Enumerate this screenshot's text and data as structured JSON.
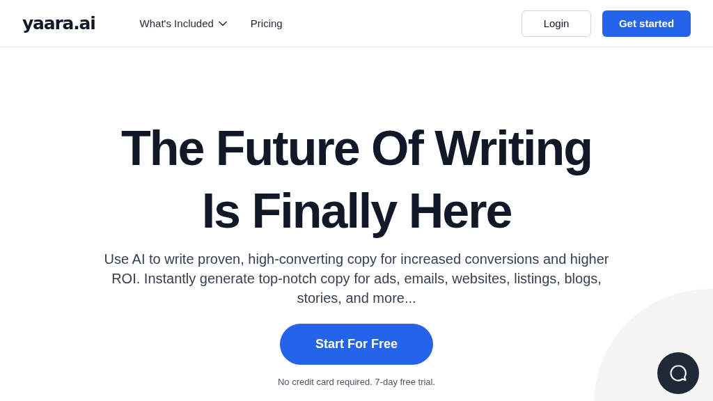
{
  "header": {
    "logo": "yaara.ai",
    "nav": [
      {
        "label": "What's Included",
        "dropdown": true
      },
      {
        "label": "Pricing",
        "dropdown": false
      }
    ],
    "buttons": [
      {
        "label": "Login",
        "kind": "outline"
      },
      {
        "label": "Get started",
        "kind": "primary"
      }
    ]
  },
  "hero": {
    "title_lines": [
      "The Future Of Writing",
      "Is Finally Here"
    ],
    "subtitle": "Use AI to write proven, high-converting copy for increased conversions and higher ROI. Instantly generate top-notch copy for ads, emails, websites, listings, blogs, stories, and more...",
    "cta": "Start For Free",
    "note": "No credit card required. 7-day free trial."
  }
}
